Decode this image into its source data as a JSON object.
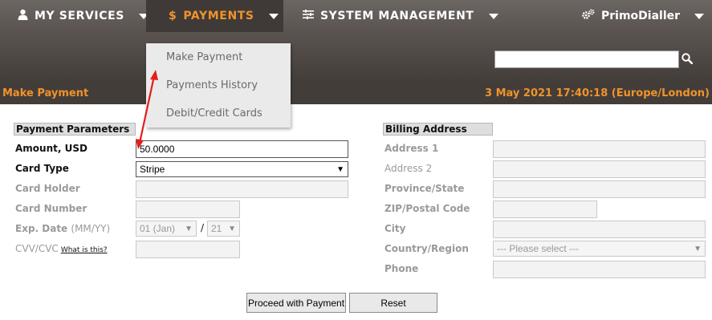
{
  "nav": {
    "my_services": "MY SERVICES",
    "payments": "PAYMENTS",
    "system_management": "SYSTEM MANAGEMENT",
    "account": "PrimoDialler"
  },
  "dropdown": {
    "items": [
      "Make Payment",
      "Payments History",
      "Debit/Credit Cards"
    ]
  },
  "strip": {
    "page_title": "Make Payment",
    "datetime": "3 May 2021 17:40:18 (Europe/London)"
  },
  "payment": {
    "section_title": "Payment Parameters",
    "amount_label": "Amount, USD",
    "amount_value": "50.0000",
    "card_type_label": "Card Type",
    "card_type_value": "Stripe",
    "card_holder_label": "Card Holder",
    "card_number_label": "Card Number",
    "exp_label": "Exp. Date",
    "exp_format": "(MM/YY)",
    "exp_month": "01 (Jan)",
    "exp_year": "21",
    "exp_sep": "/",
    "cvv_label": "CVV/CVC",
    "cvv_help": "What is this?"
  },
  "billing": {
    "section_title": "Billing Address",
    "address1": "Address 1",
    "address2": "Address 2",
    "province": "Province/State",
    "zip": "ZIP/Postal Code",
    "city": "City",
    "country": "Country/Region",
    "country_placeholder": "--- Please select ---",
    "phone": "Phone"
  },
  "actions": {
    "proceed": "Proceed with Payment",
    "reset": "Reset"
  },
  "colors": {
    "accent": "#f0932a",
    "header_dark": "#433d3a",
    "annotation_arrow": "#e31e1e"
  }
}
